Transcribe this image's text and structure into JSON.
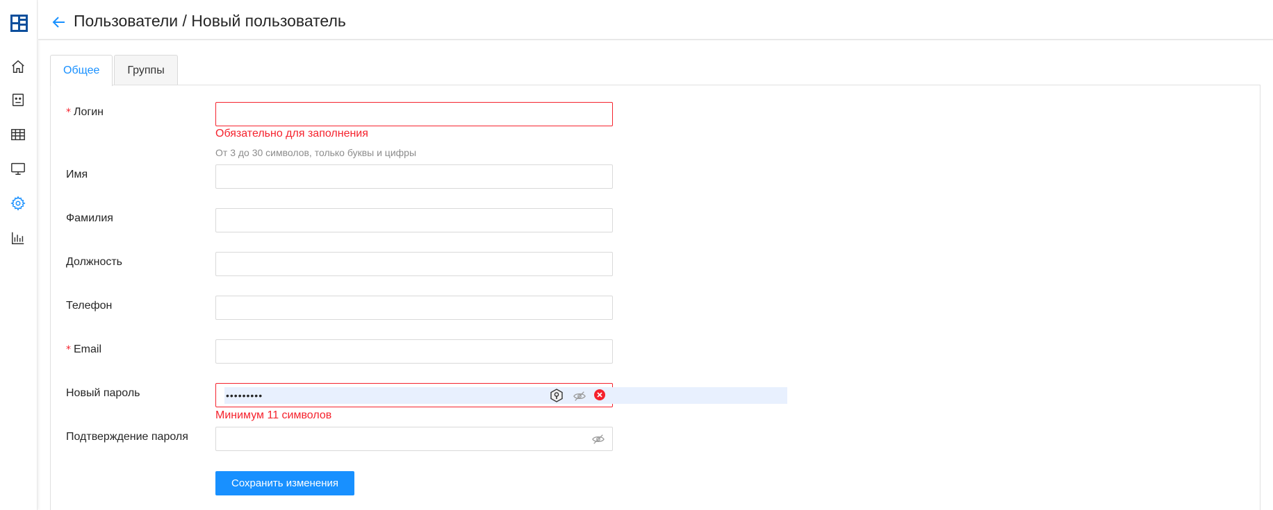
{
  "header": {
    "title": "Пользователи / Новый пользователь"
  },
  "sidebar": {
    "items": [
      {
        "icon": "home-icon"
      },
      {
        "icon": "badge-icon"
      },
      {
        "icon": "table-icon"
      },
      {
        "icon": "monitor-icon"
      },
      {
        "icon": "gear-icon",
        "active": true
      },
      {
        "icon": "bar-chart-icon"
      }
    ]
  },
  "tabs": [
    {
      "label": "Общее",
      "active": true
    },
    {
      "label": "Группы",
      "active": false
    }
  ],
  "form": {
    "login": {
      "label": "Логин",
      "required_mark": "*",
      "value": "",
      "error": "Обязательно для заполнения",
      "hint": "От 3 до 30 символов, только буквы и цифры"
    },
    "first_name": {
      "label": "Имя",
      "value": ""
    },
    "last_name": {
      "label": "Фамилия",
      "value": ""
    },
    "position": {
      "label": "Должность",
      "value": ""
    },
    "phone": {
      "label": "Телефон",
      "value": ""
    },
    "email": {
      "label": "Email",
      "required_mark": "*",
      "value": ""
    },
    "new_password": {
      "label": "Новый пароль",
      "masked_value": "•••••••••",
      "error": "Минимум 11 символов"
    },
    "confirm_password": {
      "label": "Подтверждение пароля",
      "value": ""
    },
    "save_label": "Сохранить изменения"
  },
  "colors": {
    "accent": "#1890ff",
    "error": "#f5222d",
    "logo": "#0d4f9c"
  }
}
